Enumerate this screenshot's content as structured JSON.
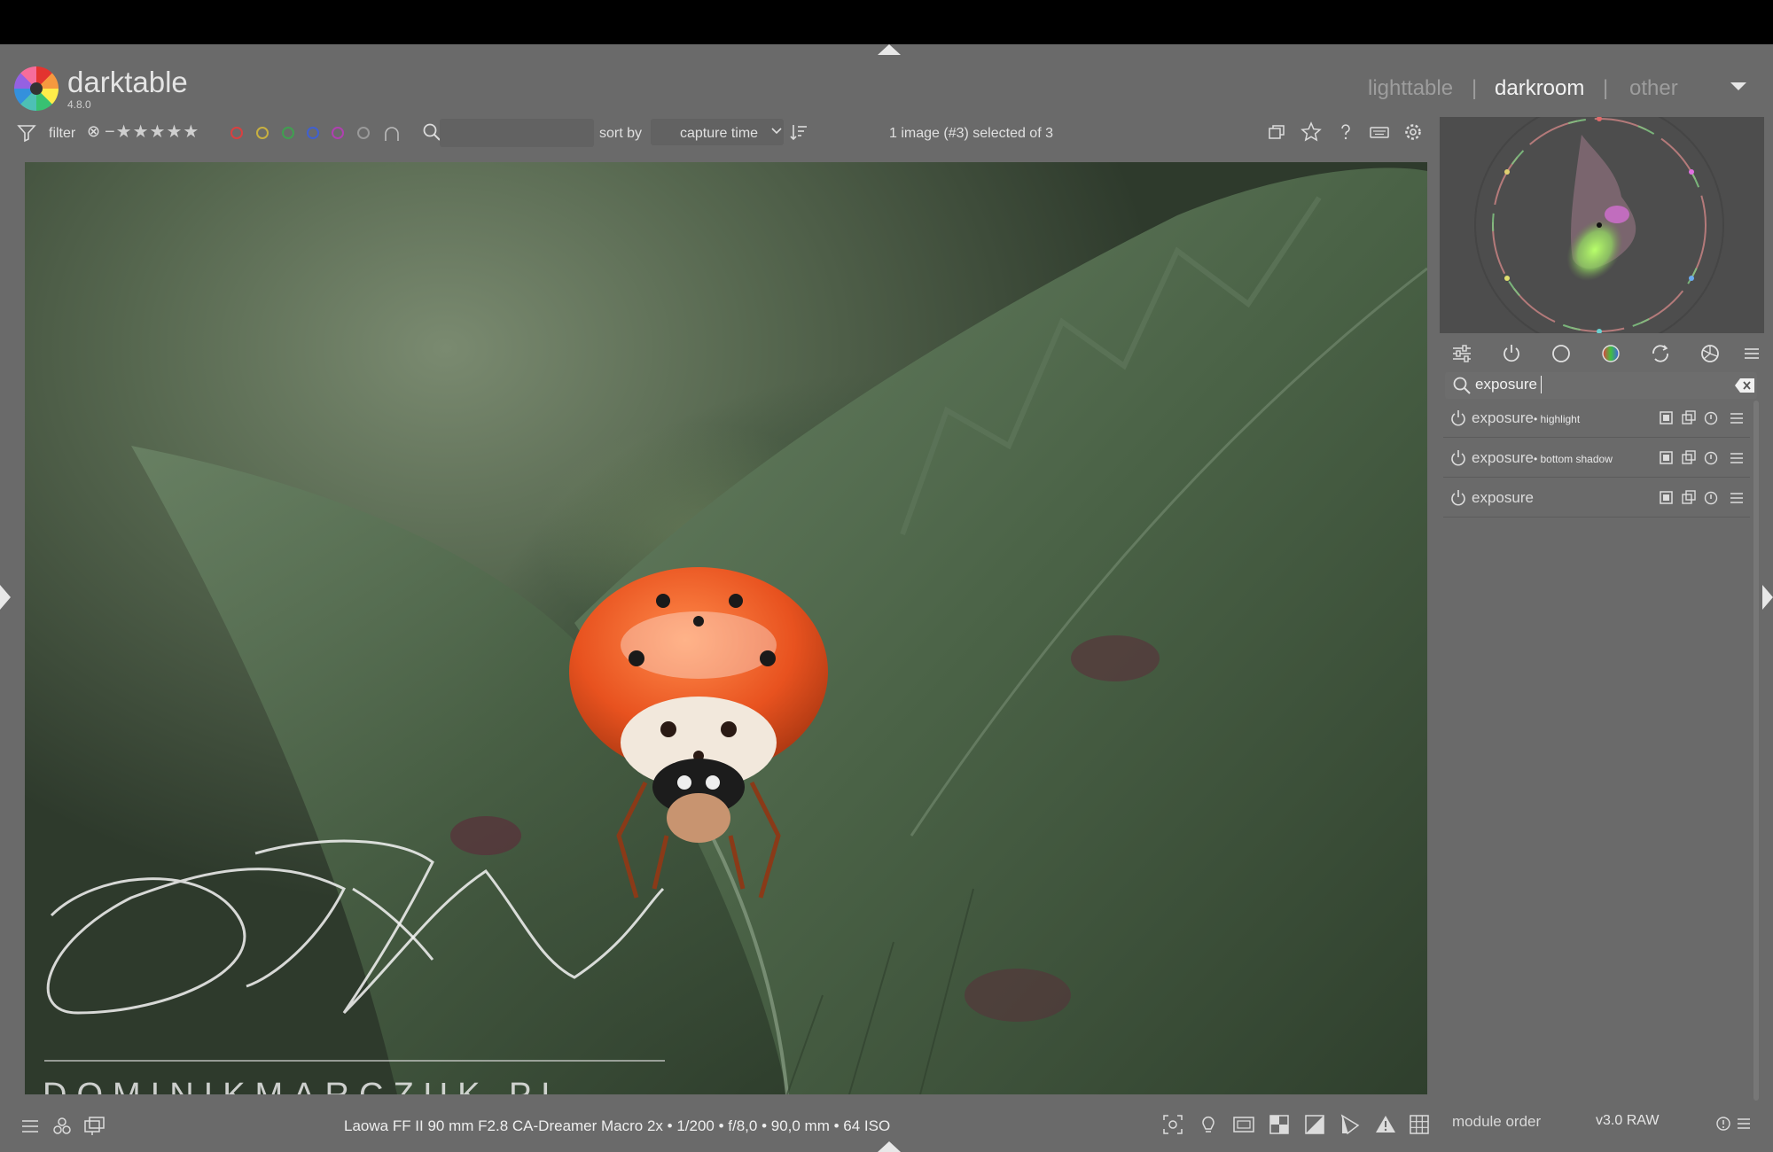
{
  "app": {
    "name": "darktable",
    "version": "4.8.0"
  },
  "views": {
    "lighttable": "lighttable",
    "darkroom": "darkroom",
    "other": "other",
    "separator": "|"
  },
  "toolbar": {
    "filter_label": "filter",
    "rating_reject": "⊗",
    "rating_stars": "−★★★★★",
    "search_placeholder": "",
    "sortby_label": "sort by",
    "sort_value": "capture time",
    "selection_status": "1 image (#3) selected of 3"
  },
  "color_labels": [
    "#d94040",
    "#c8b040",
    "#40a050",
    "#4060d0",
    "#b040b0",
    "#9a9a9a"
  ],
  "icons": {
    "filter": "filter-icon",
    "search": "search-icon",
    "sort_order": "sort-order-icon",
    "grouping": "grouping-icon",
    "star_overlay": "star-icon",
    "help": "help-icon",
    "shortcuts": "keyboard-icon",
    "preferences": "gear-icon"
  },
  "module_search": {
    "value": "exposure"
  },
  "modules": [
    {
      "name": "exposure",
      "instance": "• highlight"
    },
    {
      "name": "exposure",
      "instance": "• bottom shadow"
    },
    {
      "name": "exposure",
      "instance": ""
    }
  ],
  "image": {
    "info": "Laowa FF II 90 mm F2.8 CA-Dreamer Macro 2x • 1/200 • f/8,0 • 90,0 mm • 64 ISO",
    "watermark_signature": "Dominik Marczuk",
    "watermark_site": "DOMINIKMARCZUK.PL"
  },
  "right_footer": {
    "module_order_label": "module order",
    "module_order_value": "v3.0 RAW"
  }
}
